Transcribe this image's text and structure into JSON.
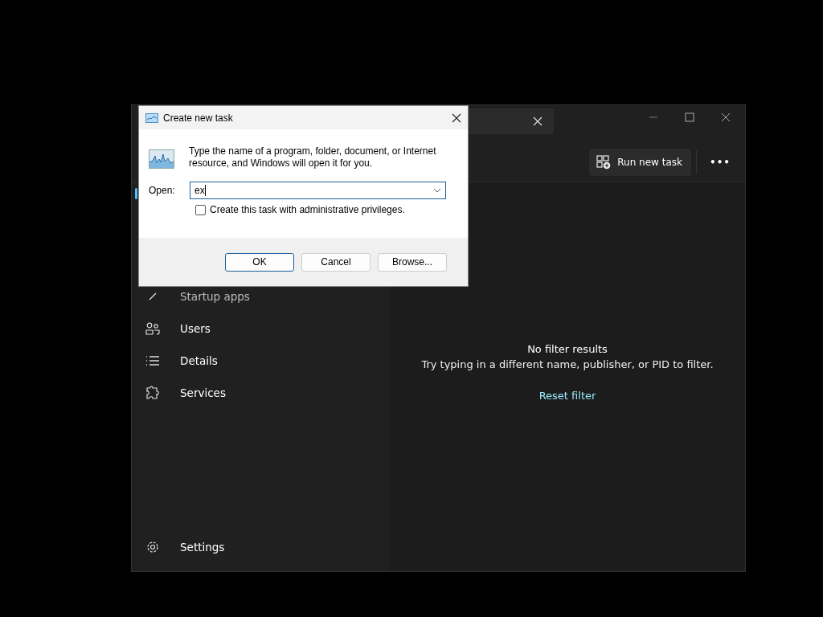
{
  "toolbar": {
    "run_button": "Run new task",
    "more_button": "•••"
  },
  "sidebar": {
    "items": [
      {
        "label": "Startup apps",
        "kind": "startup"
      },
      {
        "label": "Users",
        "kind": "users"
      },
      {
        "label": "Details",
        "kind": "details"
      },
      {
        "label": "Services",
        "kind": "services"
      }
    ],
    "footer": {
      "label": "Settings",
      "kind": "settings"
    }
  },
  "content": {
    "title": "No filter results",
    "message": "Try typing in a different name, publisher, or PID to filter.",
    "link": "Reset filter"
  },
  "dialog": {
    "title": "Create new task",
    "description": "Type the name of a program, folder, document, or Internet resource, and Windows will open it for you.",
    "open_label": "Open:",
    "open_value": "ex",
    "admin_checkbox": {
      "label": "Create this task with administrative privileges.",
      "checked": false
    },
    "buttons": [
      {
        "label": "OK",
        "default": true
      },
      {
        "label": "Cancel",
        "default": false
      },
      {
        "label": "Browse...",
        "default": false
      }
    ]
  }
}
